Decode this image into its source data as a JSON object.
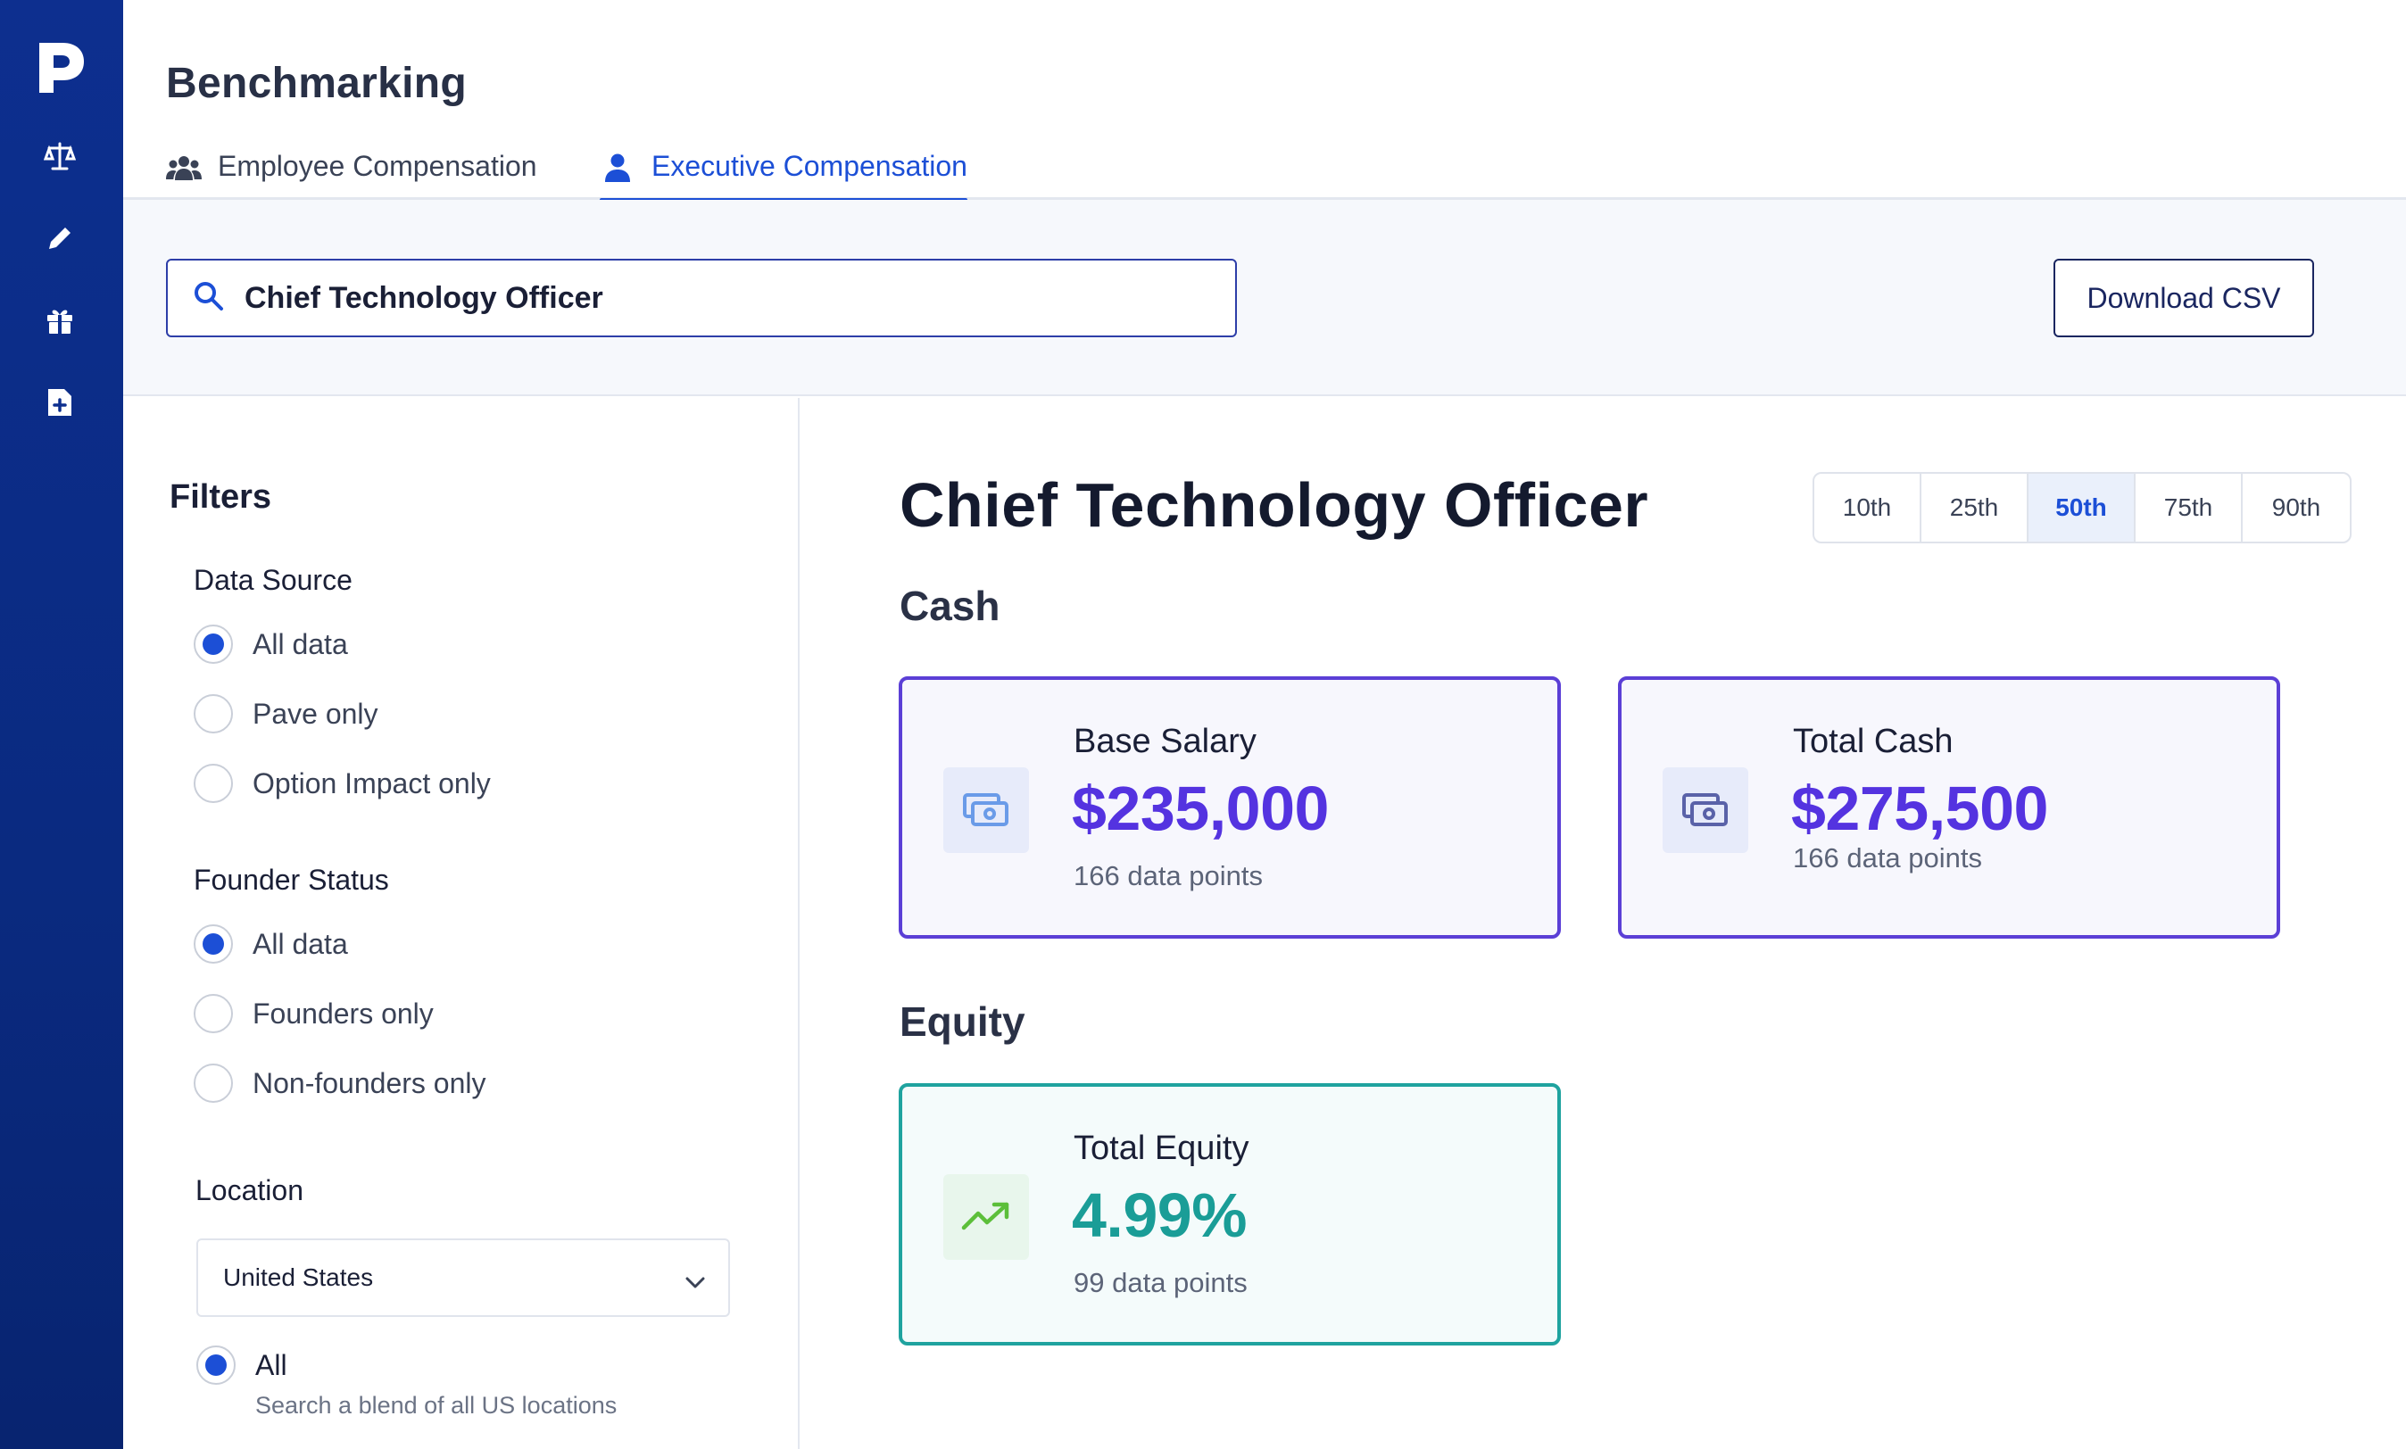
{
  "sidebar": {
    "logo_text": "P",
    "items": [
      {
        "icon": "scale-icon"
      },
      {
        "icon": "pencil-icon"
      },
      {
        "icon": "gift-icon"
      },
      {
        "icon": "document-plus-icon"
      }
    ]
  },
  "header": {
    "title": "Benchmarking",
    "tabs": [
      {
        "label": "Employee Compensation",
        "icon": "people-icon",
        "active": false
      },
      {
        "label": "Executive Compensation",
        "icon": "person-icon",
        "active": true
      }
    ]
  },
  "search": {
    "value": "Chief Technology Officer",
    "download_label": "Download CSV"
  },
  "filters": {
    "title": "Filters",
    "data_source": {
      "title": "Data Source",
      "options": [
        "All data",
        "Pave only",
        "Option Impact only"
      ],
      "selected": "All data"
    },
    "founder_status": {
      "title": "Founder Status",
      "options": [
        "All data",
        "Founders only",
        "Non-founders only"
      ],
      "selected": "All data"
    },
    "location": {
      "title": "Location",
      "selected_value": "United States",
      "radio_label": "All",
      "radio_helper": "Search a blend of all US locations"
    }
  },
  "main": {
    "role_title": "Chief Technology Officer",
    "percentiles": [
      "10th",
      "25th",
      "50th",
      "75th",
      "90th"
    ],
    "active_percentile": "50th",
    "cash_title": "Cash",
    "equity_title": "Equity",
    "cards": {
      "base_salary": {
        "label": "Base Salary",
        "value": "$235,000",
        "sub": "166 data points",
        "icon": "money-icon"
      },
      "total_cash": {
        "label": "Total Cash",
        "value": "$275,500",
        "sub": "166 data points",
        "icon": "money-icon"
      },
      "total_equity": {
        "label": "Total Equity",
        "value": "4.99%",
        "sub": "99 data points",
        "icon": "trending-up-icon"
      }
    }
  },
  "colors": {
    "sidebar": "#0d2f8f",
    "accent": "#1c4fd6",
    "cash_value": "#5433e0",
    "equity_value": "#1a9d97"
  }
}
